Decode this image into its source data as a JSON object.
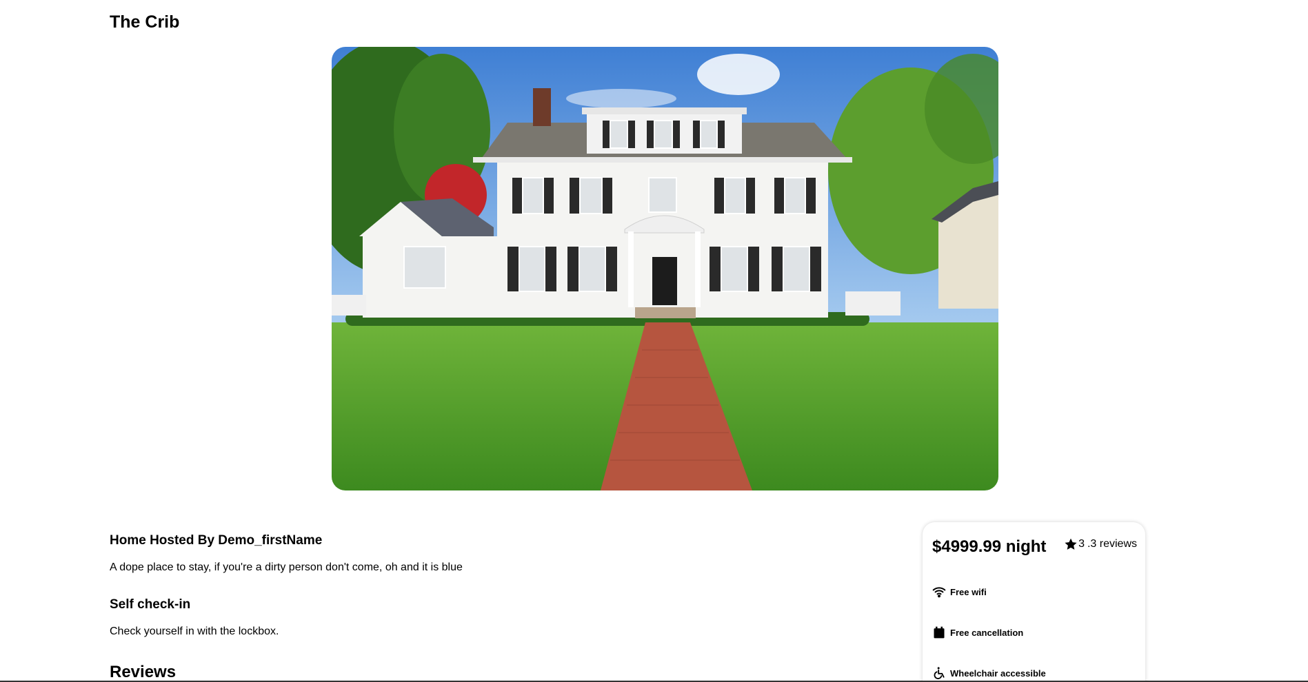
{
  "listing": {
    "title": "The Crib",
    "host_heading": "Home Hosted By Demo_firstName",
    "description": "A dope place to stay, if you're a dirty person don't come, oh and it is blue",
    "checkin_heading": "Self check-in",
    "checkin_text": "Check yourself in with the lockbox.",
    "reviews_heading": "Reviews",
    "photo_icon": "house-photo"
  },
  "booking": {
    "price": "$4999.99 night",
    "rating": "3",
    "reviews": ".3 reviews",
    "star_icon": "star-icon"
  },
  "amenities": [
    {
      "label": "Free wifi",
      "icon": "wifi-icon"
    },
    {
      "label": "Free cancellation",
      "icon": "calendar-icon"
    },
    {
      "label": "Wheelchair accessible",
      "icon": "wheelchair-icon"
    }
  ]
}
